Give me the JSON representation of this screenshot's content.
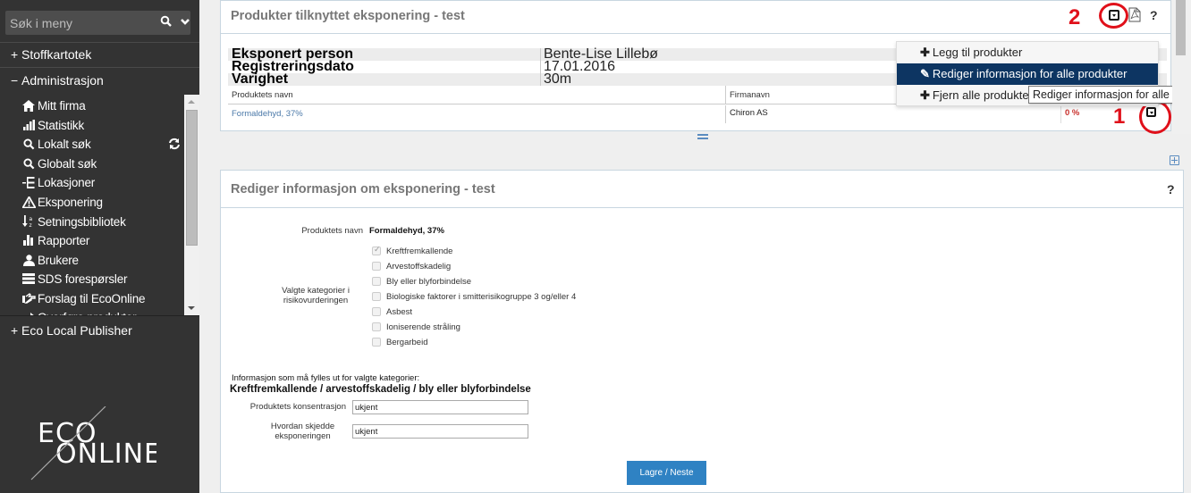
{
  "sidebar": {
    "search_placeholder": "Søk i meny",
    "sections": [
      {
        "sign": "+",
        "label": "Stoffkartotek"
      },
      {
        "sign": "−",
        "label": "Administrasjon"
      },
      {
        "sign": "+",
        "label": "Eco Local Publisher"
      }
    ],
    "items": [
      {
        "icon": "home-icon",
        "label": "Mitt firma"
      },
      {
        "icon": "bar-chart-icon",
        "label": "Statistikk"
      },
      {
        "icon": "search-icon",
        "label": "Lokalt søk"
      },
      {
        "icon": "search-icon",
        "label": "Globalt søk"
      },
      {
        "icon": "sitemap-icon",
        "label": "Lokasjoner"
      },
      {
        "icon": "warning-icon",
        "label": "Eksponering"
      },
      {
        "icon": "sort-alpha-icon",
        "label": "Setningsbibliotek"
      },
      {
        "icon": "bar-chart-icon",
        "label": "Rapporter"
      },
      {
        "icon": "user-icon",
        "label": "Brukere"
      },
      {
        "icon": "list-icon",
        "label": "SDS forespørsler"
      },
      {
        "icon": "hand-pointer-icon",
        "label": "Forslag til EcoOnline"
      },
      {
        "icon": "export-icon",
        "label": "Overføre produkter"
      }
    ],
    "logo_line1": "ECO",
    "logo_line2": "ONLINE"
  },
  "panel1": {
    "title": "Produkter tilknyttet eksponering - test",
    "info": [
      {
        "key": "Eksponert person",
        "value": "Bente-Lise Lillebø"
      },
      {
        "key": "Registreringsdato",
        "value": "17.01.2016"
      },
      {
        "key": "Varighet",
        "value": "30m"
      }
    ],
    "columns": [
      "Produktets navn",
      "Firmanavn"
    ],
    "rows": [
      {
        "name": "Formaldehyd, 37%",
        "company": "Chiron AS",
        "percent": "0 %"
      }
    ],
    "help": "?"
  },
  "dropdown": {
    "items": [
      {
        "label": "Legg til produkter",
        "icon": "plus-icon"
      },
      {
        "label": "Rediger informasjon for alle produkter",
        "icon": "edit-icon"
      },
      {
        "label": "Fjern alle produkter",
        "icon": "plus-icon"
      }
    ],
    "tooltip": "Rediger informasjon for alle produkter"
  },
  "annotations": {
    "one": "1",
    "two": "2"
  },
  "panel2": {
    "title": "Rediger informasjon om eksponering - test",
    "help": "?",
    "product_label": "Produktets navn",
    "product_value": "Formaldehyd, 37%",
    "categories_label_1": "Valgte kategorier i",
    "categories_label_2": "risikovurderingen",
    "categories": [
      {
        "label": "Kreftfremkallende",
        "checked": true
      },
      {
        "label": "Arvestoffskadelig",
        "checked": false
      },
      {
        "label": "Bly eller blyforbindelse",
        "checked": false
      },
      {
        "label": "Biologiske faktorer i smitterisikogruppe 3 og/eller 4",
        "checked": false
      },
      {
        "label": "Asbest",
        "checked": false
      },
      {
        "label": "Ioniserende stråling",
        "checked": false
      },
      {
        "label": "Bergarbeid",
        "checked": false
      }
    ],
    "info_heading": "Informasjon som må fylles ut for valgte kategorier:",
    "category_heading": "Kreftfremkallende / arvestoffskadelig / bly eller blyforbindelse",
    "fields": [
      {
        "label": "Produktets konsentrasjon",
        "value": "ukjent"
      },
      {
        "label_1": "Hvordan skjedde",
        "label_2": "eksponeringen",
        "value": "ukjent"
      }
    ],
    "save_label": "Lagre / Neste"
  }
}
